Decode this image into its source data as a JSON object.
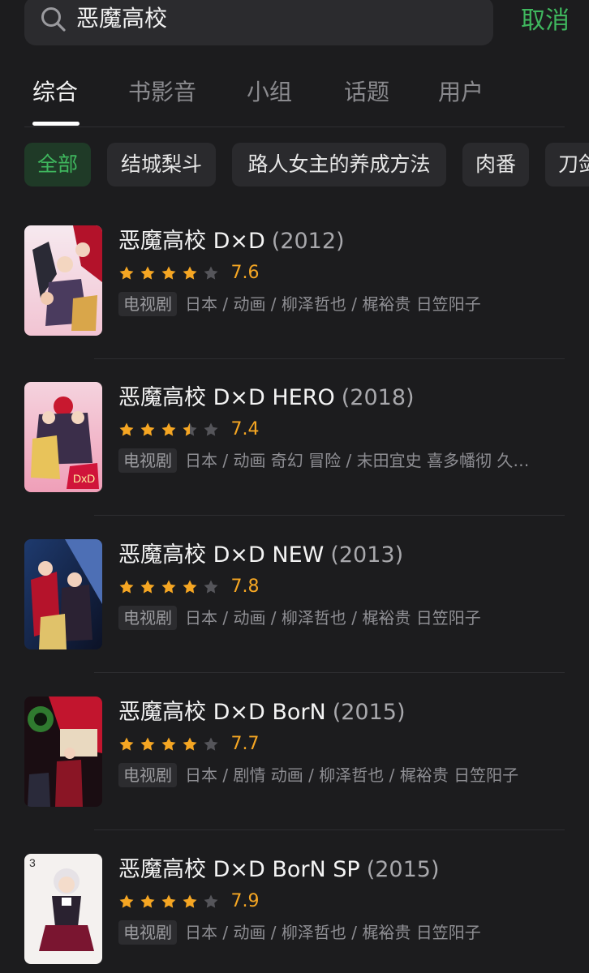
{
  "search": {
    "query": "恶魔高校",
    "cancel_label": "取消"
  },
  "tabs": [
    {
      "label": "综合",
      "active": true
    },
    {
      "label": "书影音",
      "active": false
    },
    {
      "label": "小组",
      "active": false
    },
    {
      "label": "话题",
      "active": false
    },
    {
      "label": "用户",
      "active": false
    }
  ],
  "chips": [
    {
      "label": "全部",
      "active": true
    },
    {
      "label": "结城梨斗",
      "active": false
    },
    {
      "label": "路人女主的养成方法",
      "active": false
    },
    {
      "label": "肉番",
      "active": false
    },
    {
      "label": "刀剑",
      "active": false
    }
  ],
  "results": [
    {
      "title": "恶魔高校 D×D",
      "year": "(2012)",
      "rating": 7.6,
      "stars": 4,
      "score": "7.6",
      "tag": "电视剧",
      "meta": "日本 / 动画 / 柳泽哲也 / 梶裕贵 日笠阳子"
    },
    {
      "title": "恶魔高校 D×D HERO",
      "year": "(2018)",
      "rating": 7.4,
      "stars": 3.5,
      "score": "7.4",
      "tag": "电视剧",
      "meta": "日本 / 动画 奇幻 冒险 / 末田宜史 喜多幡彻 久…"
    },
    {
      "title": "恶魔高校 D×D NEW",
      "year": "(2013)",
      "rating": 7.8,
      "stars": 4,
      "score": "7.8",
      "tag": "电视剧",
      "meta": "日本 / 动画 / 柳泽哲也 / 梶裕贵 日笠阳子"
    },
    {
      "title": "恶魔高校 D×D BorN",
      "year": "(2015)",
      "rating": 7.7,
      "stars": 4,
      "score": "7.7",
      "tag": "电视剧",
      "meta": "日本 / 剧情 动画 / 柳泽哲也 / 梶裕贵 日笠阳子"
    },
    {
      "title": "恶魔高校 D×D BorN SP",
      "year": "(2015)",
      "rating": 7.9,
      "stars": 4,
      "score": "7.9",
      "tag": "电视剧",
      "meta": "日本 / 动画 / 柳泽哲也 / 梶裕贵 日笠阳子"
    }
  ],
  "colors": {
    "background": "#1c1c1e",
    "accent_green": "#3fb75e",
    "star_orange": "#f5a623",
    "star_empty": "#55555a"
  },
  "icons": {
    "search": "search-icon",
    "star": "star-icon"
  }
}
